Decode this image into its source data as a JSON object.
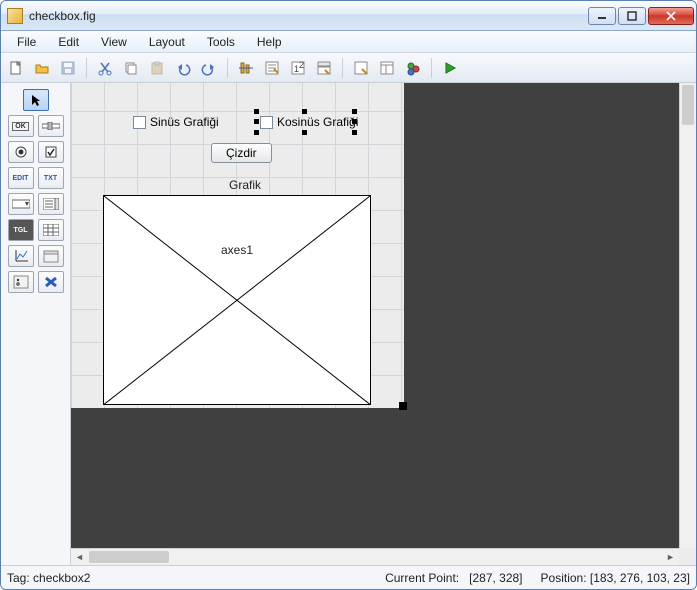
{
  "window": {
    "title": "checkbox.fig"
  },
  "menubar": {
    "file": "File",
    "edit": "Edit",
    "view": "View",
    "layout": "Layout",
    "tools": "Tools",
    "help": "Help"
  },
  "palette": {
    "ok": "OK",
    "slider": "▭",
    "edit": "EDIT",
    "txt": "TXT",
    "tgl": "TGL"
  },
  "canvas": {
    "checkbox1_label": "Sinüs Grafiği",
    "checkbox2_label": "Kosinüs Grafiği",
    "pushbutton_label": "Çizdir",
    "axes_title": "Grafik",
    "axes_label": "axes1"
  },
  "statusbar": {
    "tag_label": "Tag:",
    "tag_value": "checkbox2",
    "cp_label": "Current Point:",
    "cp_value": "[287, 328]",
    "pos_label": "Position:",
    "pos_value": "[183, 276, 103, 23]"
  }
}
